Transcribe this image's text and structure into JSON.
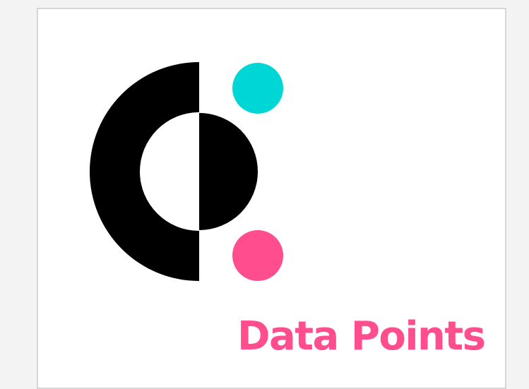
{
  "brand": {
    "name": "Data Points",
    "colors": {
      "mark": "#000000",
      "accent_top": "#00d6d6",
      "accent_bottom": "#ff4d8d",
      "wordmark": "#ff4d8d",
      "background": "#f3f3f3",
      "card": "#ffffff",
      "card_border": "#d6d6d6"
    },
    "icon": "data-points-logo-icon"
  }
}
